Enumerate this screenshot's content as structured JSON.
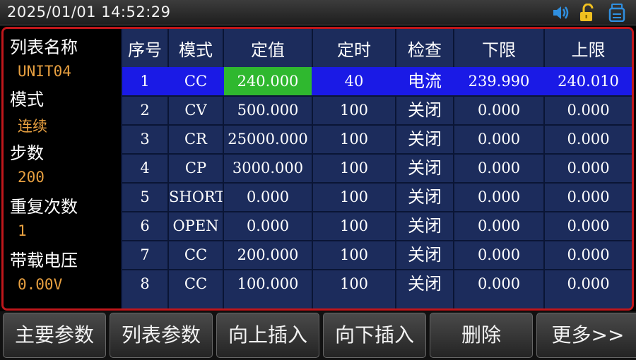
{
  "status_bar": {
    "datetime": "2025/01/01   14:52:29",
    "icons": [
      "speaker-icon",
      "unlock-icon",
      "usb-disk-icon"
    ]
  },
  "sidebar": {
    "list_name_label": "列表名称",
    "list_name_value": "UNIT04",
    "mode_label": "模式",
    "mode_value": "连续",
    "steps_label": "步数",
    "steps_value": "200",
    "repeat_label": "重复次数",
    "repeat_value": "1",
    "load_voltage_label": "带载电压",
    "load_voltage_value": "0.00V"
  },
  "table": {
    "headers": [
      "序号",
      "模式",
      "定值",
      "定时",
      "检查",
      "下限",
      "上限"
    ],
    "rows": [
      [
        "1",
        "CC",
        "240.000",
        "40",
        "电流",
        "239.990",
        "240.010"
      ],
      [
        "2",
        "CV",
        "500.000",
        "100",
        "关闭",
        "0.000",
        "0.000"
      ],
      [
        "3",
        "CR",
        "25000.000",
        "100",
        "关闭",
        "0.000",
        "0.000"
      ],
      [
        "4",
        "CP",
        "3000.000",
        "100",
        "关闭",
        "0.000",
        "0.000"
      ],
      [
        "5",
        "SHORT",
        "0.000",
        "100",
        "关闭",
        "0.000",
        "0.000"
      ],
      [
        "6",
        "OPEN",
        "0.000",
        "100",
        "关闭",
        "0.000",
        "0.000"
      ],
      [
        "7",
        "CC",
        "200.000",
        "100",
        "关闭",
        "0.000",
        "0.000"
      ],
      [
        "8",
        "CC",
        "100.000",
        "100",
        "关闭",
        "0.000",
        "0.000"
      ]
    ],
    "selected_row": 0,
    "selected_col": 2
  },
  "softkeys": [
    "主要参数",
    "列表参数",
    "向上插入",
    "向下插入",
    "删除",
    "更多>>"
  ],
  "colors": {
    "frame": "#c0171b",
    "selected_row": "#1a1ae6",
    "selected_cell": "#2fb82f",
    "sidebar_value": "#e8a040",
    "column_bg": "#1c2c5c"
  }
}
